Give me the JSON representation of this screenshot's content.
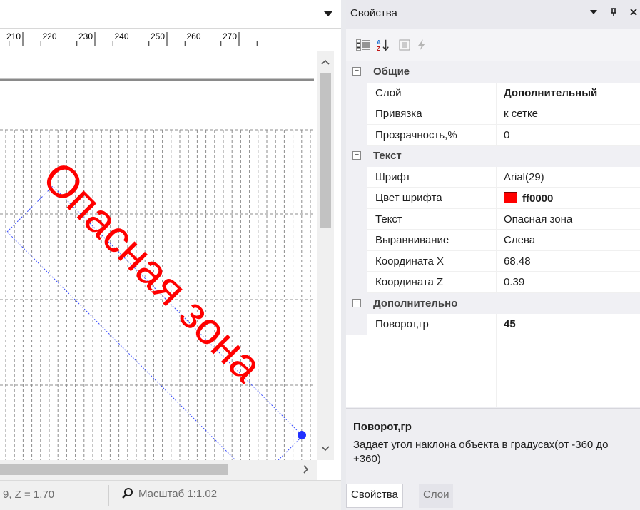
{
  "ruler": {
    "labels": [
      "210",
      "220",
      "230",
      "240",
      "250",
      "260",
      "270"
    ]
  },
  "canvas": {
    "text_object": {
      "text": "Опасная зона",
      "color": "#ff0000",
      "rotation_deg": 45
    }
  },
  "status": {
    "coord": "9, Z = 1.70",
    "zoom": "Масштаб 1:1.02"
  },
  "panel": {
    "title": "Свойства",
    "categories": [
      {
        "label": "Общие",
        "toggle": "⊟",
        "props": [
          {
            "name": "Слой",
            "value": "Дополнительный",
            "bold": true
          },
          {
            "name": "Привязка",
            "value": "к сетке"
          },
          {
            "name": "Прозрачность,%",
            "value": "0"
          }
        ]
      },
      {
        "label": "Текст",
        "toggle": "⊟",
        "props": [
          {
            "name": "Шрифт",
            "value": "Arial(29)"
          },
          {
            "name": "Цвет шрифта",
            "value": "ff0000",
            "bold": true,
            "swatch": "#ff0000"
          },
          {
            "name": "Текст",
            "value": "Опасная зона"
          },
          {
            "name": "Выравнивание",
            "value": "Слева"
          },
          {
            "name": "Координата X",
            "value": "68.48"
          },
          {
            "name": "Координата Z",
            "value": "0.39"
          }
        ]
      },
      {
        "label": "Дополнительно",
        "toggle": "⊟",
        "props": [
          {
            "name": "Поворот,гр",
            "value": "45",
            "bold": true
          }
        ]
      }
    ],
    "description": {
      "title": "Поворот,гр",
      "text": "Задает угол наклона объекта в градусах(от -360 до +360)"
    },
    "tabs": [
      {
        "label": "Свойства",
        "active": true
      },
      {
        "label": "Слои",
        "active": false
      }
    ]
  },
  "icons": [
    "categorized-icon",
    "alphabetical-sort-icon",
    "property-pages-icon",
    "events-icon",
    "pin-icon",
    "close-icon",
    "dropdown-arrow-icon",
    "search-icon"
  ]
}
